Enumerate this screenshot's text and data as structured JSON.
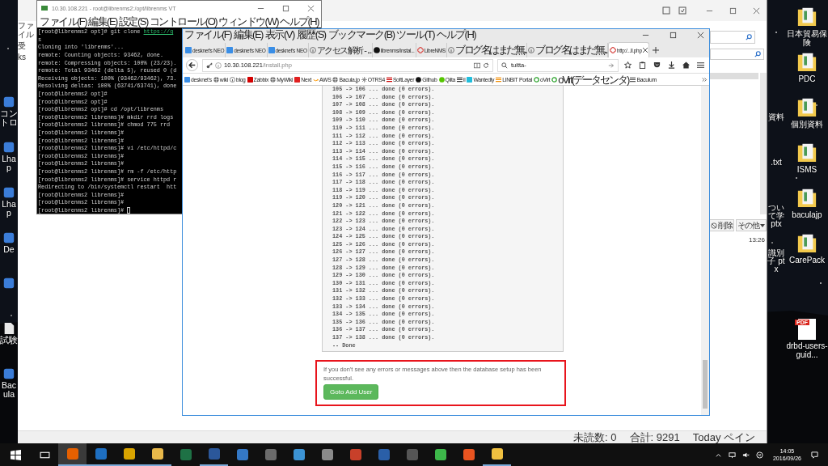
{
  "desktop": {
    "left_icons": [
      {
        "label": "コントロ",
        "kind": "app"
      },
      {
        "label": "Lhap",
        "kind": "app"
      },
      {
        "label": "Lhap",
        "kind": "app"
      },
      {
        "label": "De",
        "kind": "app"
      },
      {
        "kind": "app"
      },
      {
        "label": "試験",
        "kind": "file"
      },
      {
        "label": "Bacula",
        "kind": "app"
      }
    ],
    "middle_icons": [
      {
        "label": "資料"
      },
      {
        "label": ".txt"
      },
      {
        "label": "ついて学 ptx"
      },
      {
        "label": "識別子 ptx"
      }
    ],
    "right_icons": [
      {
        "label": "日本貿易保険",
        "kind": "folder"
      },
      {
        "label": "PDC",
        "kind": "folder"
      },
      {
        "label": "個別資料",
        "kind": "folder"
      },
      {
        "label": "ISMS",
        "kind": "folder"
      },
      {
        "label": "baculajp",
        "kind": "folder"
      },
      {
        "label": "CarePack",
        "kind": "folder"
      },
      {
        "label": "drbd-users-guid...",
        "kind": "pdf",
        "badge": "PDF"
      }
    ]
  },
  "mail_window": {
    "left_pane": [
      "ファイル",
      "受",
      "ks"
    ],
    "toolbar": [
      {
        "label": "削除",
        "kind": "delete"
      },
      {
        "label": "その他",
        "kind": "more"
      }
    ],
    "time": "13:26",
    "status_bar": [
      "未読数: 0",
      "合計: 9291",
      "Today ペイン"
    ]
  },
  "terminal": {
    "title": "10.30.108.221 - root@librenms2:/opt/librenms VT",
    "menu": [
      "ファイル(F)",
      "編集(E)",
      "設定(S)",
      "コントロール(O)",
      "ウィンドウ(W)",
      "ヘルプ(H)"
    ],
    "lines": [
      {
        "text": "[root@librenms2 opt]# git clone ",
        "link": "https://g"
      },
      {
        "text": "s"
      },
      {
        "text": "Cloning into 'librenms'..."
      },
      {
        "text": "remote: Counting objects: 93462, done."
      },
      {
        "text": "remote: Compressing objects: 100% (23/23)."
      },
      {
        "text": "remote: Total 93462 (delta 5), reused 0 (d"
      },
      {
        "text": "Receiving objects: 100% (93462/93462), 73."
      },
      {
        "text": "Resolving deltas: 100% (63741/63741), done"
      },
      {
        "text": "[root@librenms2 opt]#"
      },
      {
        "text": "[root@librenms2 opt]#"
      },
      {
        "text": "[root@librenms2 opt]# cd /opt/librenms"
      },
      {
        "text": "[root@librenms2 librenms]# mkdir rrd logs"
      },
      {
        "text": "[root@librenms2 librenms]# chmod 775 rrd"
      },
      {
        "text": "[root@librenms2 librenms]#"
      },
      {
        "text": "[root@librenms2 librenms]#"
      },
      {
        "text": "[root@librenms2 librenms]# vi /etc/httpd/c"
      },
      {
        "text": "[root@librenms2 librenms]#"
      },
      {
        "text": "[root@librenms2 librenms]#"
      },
      {
        "text": "[root@librenms2 librenms]# rm -f /etc/http"
      },
      {
        "text": "[root@librenms2 librenms]# service httpd r"
      },
      {
        "text": "Redirecting to /bin/systemctl restart  htt"
      },
      {
        "text": "[root@librenms2 librenms]#"
      },
      {
        "text": "[root@librenms2 librenms]#"
      },
      {
        "text": "[root@librenms2 librenms]# ",
        "cursor": true
      }
    ]
  },
  "browser": {
    "menu": [
      "ファイル(F)",
      "編集(E)",
      "表示(V)",
      "履歴(S)",
      "ブックマーク(B)",
      "ツール(T)",
      "ヘルプ(H)"
    ],
    "tabs": [
      {
        "title": "desknet's NEO",
        "kind": "desknet",
        "selected": false
      },
      {
        "title": "desknet's NEO",
        "kind": "desknet",
        "selected": false
      },
      {
        "title": "desknet's NEO",
        "kind": "desknet",
        "selected": false
      },
      {
        "title": "アクセス解析 - ...",
        "kind": "info",
        "selected": false
      },
      {
        "title": "librenms/Instal...",
        "kind": "github",
        "selected": false
      },
      {
        "title": "LibreNMS",
        "kind": "libre",
        "selected": false
      },
      {
        "title": "ブログ名はまだ無...",
        "kind": "info",
        "selected": false
      },
      {
        "title": "ブログ名はまだ無...",
        "kind": "info",
        "selected": false
      },
      {
        "title": "http:/...ll.php",
        "kind": "libre",
        "selected": true
      }
    ],
    "url": {
      "host": "10.30.108.221",
      "path": "/install.php"
    },
    "search": {
      "value": "tuitta-"
    },
    "bookmarks": [
      {
        "label": "desknet's",
        "kind": "desknet"
      },
      {
        "label": "wiki",
        "kind": "globe"
      },
      {
        "label": "blog",
        "kind": "info"
      },
      {
        "label": "Zabbix",
        "kind": "zabbix"
      },
      {
        "label": "MyWiki",
        "kind": "globe"
      },
      {
        "label": "Next",
        "kind": "next"
      },
      {
        "label": "AWS",
        "kind": "aws"
      },
      {
        "label": "Bacula.jp",
        "kind": "globe"
      },
      {
        "label": "OTRS4",
        "kind": "otrs"
      },
      {
        "label": "SoftLayer",
        "kind": "softlayer"
      },
      {
        "label": "Github",
        "kind": "github"
      },
      {
        "label": "Qiita",
        "kind": "qiita"
      },
      {
        "label": "il",
        "kind": "il"
      },
      {
        "label": "Wantedly",
        "kind": "wantedly"
      },
      {
        "label": "LINBIT Portal",
        "kind": "linbit"
      },
      {
        "label": "oVirt",
        "kind": "ovirt"
      },
      {
        "label": "oVirt(データセンタ)",
        "kind": "ovirt"
      },
      {
        "label": "Baculum",
        "kind": "baculum"
      }
    ],
    "log_lines": [
      "105 -> 106 ... done (0 errors).",
      "106 -> 107 ... done (0 errors).",
      "107 -> 108 ... done (0 errors).",
      "108 -> 109 ... done (0 errors).",
      "109 -> 110 ... done (0 errors).",
      "110 -> 111 ... done (0 errors).",
      "111 -> 112 ... done (0 errors).",
      "112 -> 113 ... done (0 errors).",
      "113 -> 114 ... done (0 errors).",
      "114 -> 115 ... done (0 errors).",
      "115 -> 116 ... done (0 errors).",
      "116 -> 117 ... done (0 errors).",
      "117 -> 118 ... done (0 errors).",
      "118 -> 119 ... done (0 errors).",
      "119 -> 120 ... done (0 errors).",
      "120 -> 121 ... done (0 errors).",
      "121 -> 122 ... done (0 errors).",
      "122 -> 123 ... done (0 errors).",
      "123 -> 124 ... done (0 errors).",
      "124 -> 125 ... done (0 errors).",
      "125 -> 126 ... done (0 errors).",
      "126 -> 127 ... done (0 errors).",
      "127 -> 128 ... done (0 errors).",
      "128 -> 129 ... done (0 errors).",
      "129 -> 130 ... done (0 errors).",
      "130 -> 131 ... done (0 errors).",
      "131 -> 132 ... done (0 errors).",
      "132 -> 133 ... done (0 errors).",
      "133 -> 134 ... done (0 errors).",
      "134 -> 135 ... done (0 errors).",
      "135 -> 136 ... done (0 errors).",
      "136 -> 137 ... done (0 errors).",
      "137 -> 138 ... done (0 errors)."
    ],
    "log_end": "-- Done",
    "notice": {
      "text": "If you don't see any errors or messages above then the database setup has been successful.",
      "button": "Goto Add User"
    }
  },
  "taskbar": {
    "apps": [
      {
        "color": "#e66000",
        "open": true,
        "selected": true
      },
      {
        "color": "#1e6fc2",
        "open": true,
        "selected": false
      },
      {
        "color": "#d9a400",
        "open": true,
        "selected": false
      },
      {
        "color": "#e8b84a",
        "open": true,
        "selected": false
      },
      {
        "color": "#1e7145",
        "open": false,
        "selected": false
      },
      {
        "color": "#2b579a",
        "open": true,
        "selected": false
      },
      {
        "color": "#3478c6",
        "open": false,
        "selected": false
      },
      {
        "color": "#6b6b6b",
        "open": false,
        "selected": false
      },
      {
        "color": "#3c93d4",
        "open": false,
        "selected": false
      },
      {
        "color": "#8a8a8a",
        "open": false,
        "selected": false
      },
      {
        "color": "#c8402a",
        "open": false,
        "selected": false
      },
      {
        "color": "#2a5fa8",
        "open": false,
        "selected": false
      },
      {
        "color": "#555555",
        "open": false,
        "selected": false
      },
      {
        "color": "#3db84a",
        "open": false,
        "selected": false
      },
      {
        "color": "#e95420",
        "open": false,
        "selected": false
      },
      {
        "color": "#f0c040",
        "open": true,
        "selected": false
      }
    ],
    "clock": {
      "time": "14:05",
      "date": "2016/09/26"
    }
  }
}
